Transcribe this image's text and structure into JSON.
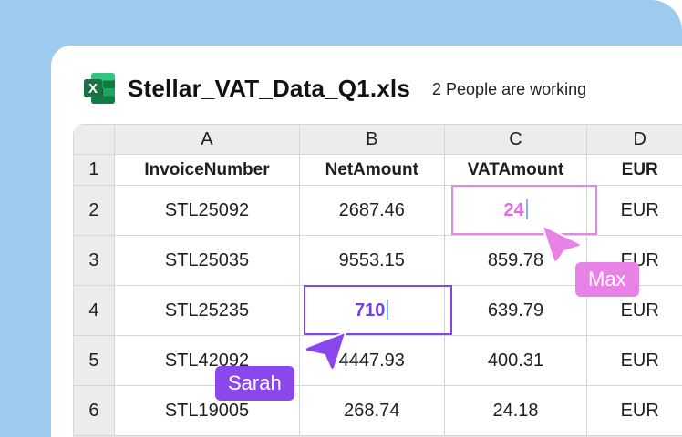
{
  "file": {
    "name": "Stellar_VAT_Data_Q1.xls",
    "collaborators_text": "2 People are working",
    "icon": "excel-icon",
    "icon_letter": "X"
  },
  "sheet": {
    "columns": [
      "A",
      "B",
      "C",
      "D"
    ],
    "rows": [
      {
        "num": "1",
        "cells": [
          "InvoiceNumber",
          "NetAmount",
          "VATAmount",
          "EUR"
        ],
        "header": true
      },
      {
        "num": "2",
        "cells": [
          "STL25092",
          "2687.46",
          "24",
          "EUR"
        ]
      },
      {
        "num": "3",
        "cells": [
          "STL25035",
          "9553.15",
          "859.78",
          "EUR"
        ]
      },
      {
        "num": "4",
        "cells": [
          "STL25235",
          "710",
          "639.79",
          "EUR"
        ]
      },
      {
        "num": "5",
        "cells": [
          "STL42092",
          "4447.93",
          "400.31",
          "EUR"
        ]
      },
      {
        "num": "6",
        "cells": [
          "STL19005",
          "268.74",
          "24.18",
          "EUR"
        ]
      }
    ]
  },
  "collaborators": [
    {
      "name": "Max",
      "color": "#e982e6",
      "editing_cell": "C2"
    },
    {
      "name": "Sarah",
      "color": "#8a48ec",
      "editing_cell": "B4"
    }
  ],
  "colors": {
    "background_panel": "#9ccbee",
    "excel_green": "#1d7044",
    "max_accent": "#e982e6",
    "sarah_accent": "#8a48ec"
  }
}
